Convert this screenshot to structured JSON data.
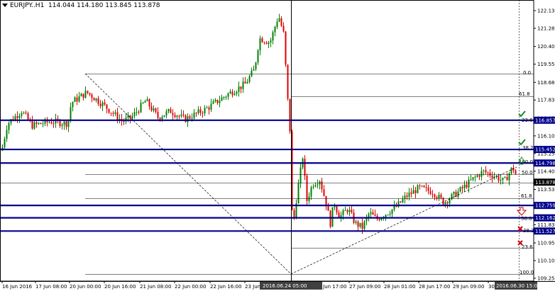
{
  "header": {
    "symbol": "EURJPY..H1",
    "ohlc": "114.044 114.180 113.845 113.878"
  },
  "price_axis": {
    "ticks": [
      "122.130",
      "121.280",
      "120.405",
      "119.555",
      "118.680",
      "117.830",
      "116.955",
      "116.105",
      "115.255",
      "114.405",
      "113.530",
      "112.680",
      "111.830",
      "110.955",
      "110.105",
      "109.255"
    ],
    "tags": [
      {
        "label": "116.857",
        "price": 116.857,
        "color": "#00008b"
      },
      {
        "label": "115.452",
        "price": 115.452,
        "color": "#00008b"
      },
      {
        "label": "114.798",
        "price": 114.798,
        "color": "#00008b"
      },
      {
        "label": "113.878",
        "price": 113.878,
        "color": "#000000"
      },
      {
        "label": "112.759",
        "price": 112.759,
        "color": "#00008b"
      },
      {
        "label": "112.162",
        "price": 112.162,
        "color": "#00008b"
      },
      {
        "label": "111.527",
        "price": 111.527,
        "color": "#00008b"
      }
    ]
  },
  "time_axis": {
    "labels": [
      "16 Jun 2016",
      "17 Jun 08:00",
      "20 Jun 00:00",
      "20 Jun 16:00",
      "21 Jun 08:00",
      "22 Jun 00:00",
      "22 Jun 16:00",
      "23 Jun 08:00",
      "24 Jun 17:00",
      "27 Jun 09:00",
      "28 Jun 01:00",
      "28 Jun 17:00",
      "29 Jun 09:00",
      "30"
    ],
    "crosshair_time": "2016.06.24 05:00",
    "right_time": "2016.06.30 15:00"
  },
  "fib_labels": [
    "0.0",
    "61.8",
    "23.6",
    "38.2",
    "100.0",
    "50.0",
    "61.8",
    "50.0",
    "38.2",
    "23.6",
    "100.0"
  ],
  "markers": {
    "check_icon": "green-checkmark-icon",
    "cross_icon": "red-x-icon",
    "up_arrow_icon": "green-up-arrow-icon",
    "down_arrow_icon": "red-down-arrow-icon"
  },
  "colors": {
    "bull": "#008000",
    "bear": "#e00000",
    "level": "#00008b",
    "grid": "#000000"
  }
}
